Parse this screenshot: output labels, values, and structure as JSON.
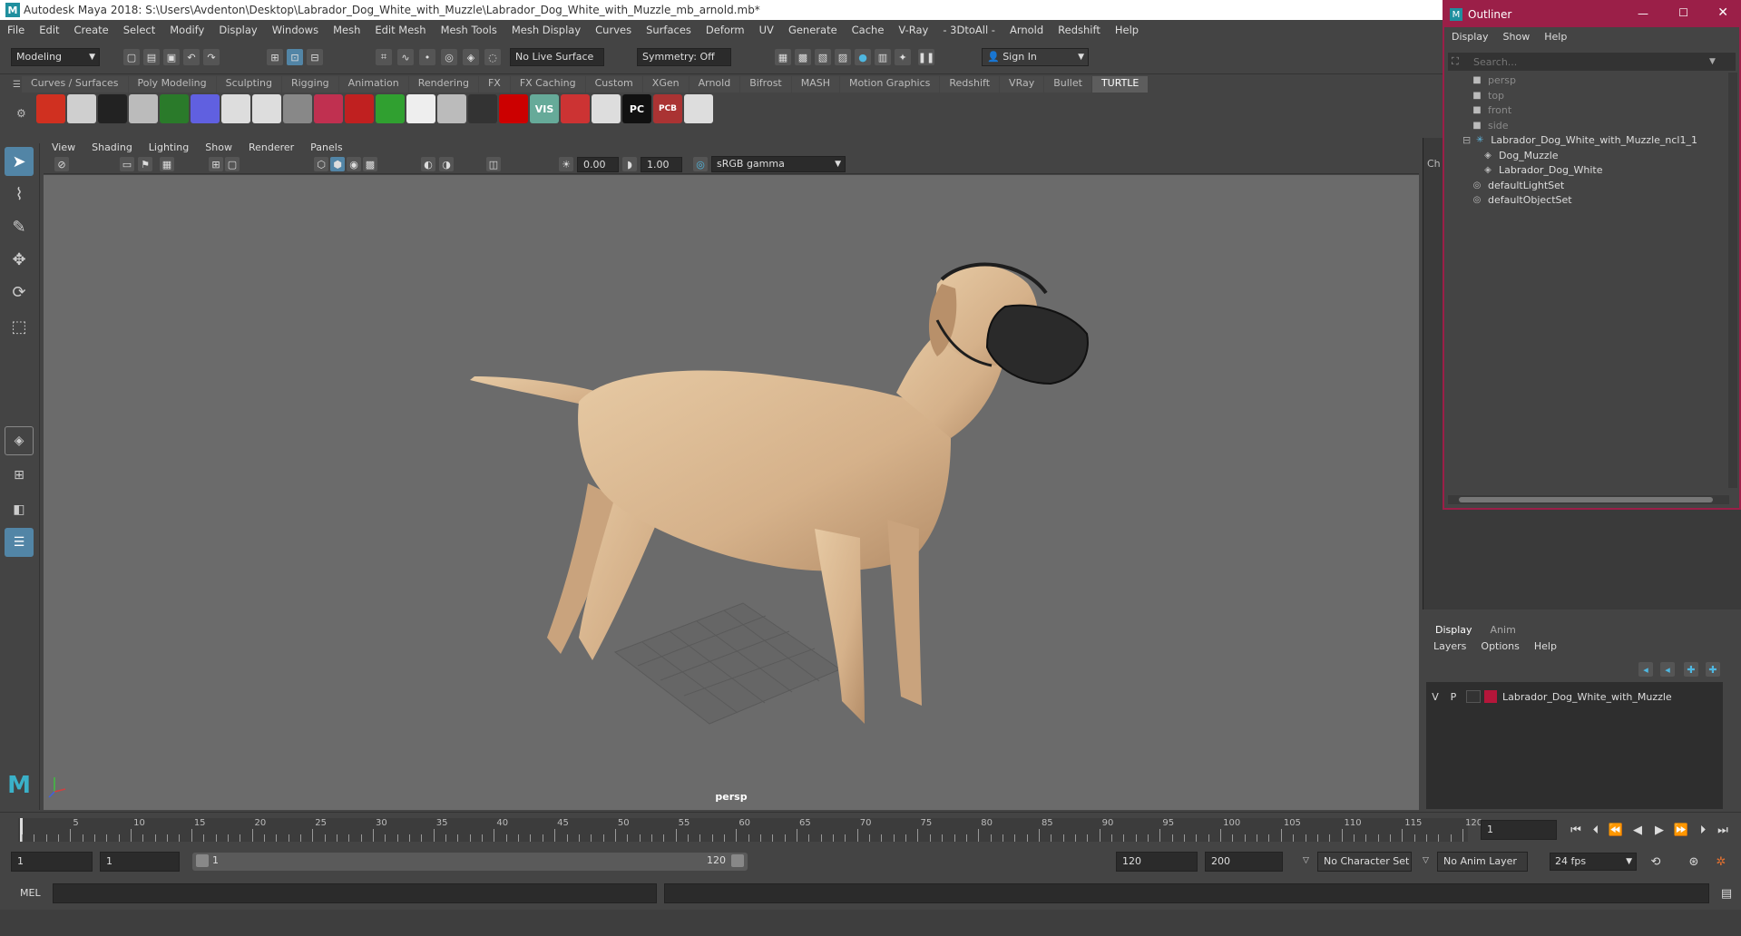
{
  "window": {
    "title": "Autodesk Maya 2018: S:\\Users\\Avdenton\\Desktop\\Labrador_Dog_White_with_Muzzle\\Labrador_Dog_White_with_Muzzle_mb_arnold.mb*"
  },
  "menubar": [
    "File",
    "Edit",
    "Create",
    "Select",
    "Modify",
    "Display",
    "Windows",
    "Mesh",
    "Edit Mesh",
    "Mesh Tools",
    "Mesh Display",
    "Curves",
    "Surfaces",
    "Deform",
    "UV",
    "Generate",
    "Cache",
    "V-Ray",
    "- 3DtoAll -",
    "Arnold",
    "Redshift",
    "Help"
  ],
  "statusline": {
    "mode": "Modeling",
    "live_surface": "No Live Surface",
    "symmetry": "Symmetry: Off",
    "sign_in": "Sign In"
  },
  "shelf_tabs": [
    "Curves / Surfaces",
    "Poly Modeling",
    "Sculpting",
    "Rigging",
    "Animation",
    "Rendering",
    "FX",
    "FX Caching",
    "Custom",
    "XGen",
    "Arnold",
    "Bifrost",
    "MASH",
    "Motion Graphics",
    "Redshift",
    "VRay",
    "Bullet",
    "TURTLE"
  ],
  "shelf_active": "TURTLE",
  "shelf_icon_labels": {
    "vis": "VIS",
    "pc": "PC",
    "pcb": "PCB"
  },
  "viewport": {
    "menu": [
      "View",
      "Shading",
      "Lighting",
      "Show",
      "Renderer",
      "Panels"
    ],
    "exposure": "0.00",
    "gamma": "1.00",
    "colorspace": "sRGB gamma",
    "camera_label": "persp"
  },
  "channel_box_label": "Ch",
  "outliner": {
    "title": "Outliner",
    "menu": [
      "Display",
      "Show",
      "Help"
    ],
    "search_placeholder": "Search...",
    "items": [
      {
        "label": "persp",
        "icon": "camera-icon",
        "dim": true,
        "indent": 0
      },
      {
        "label": "top",
        "icon": "camera-icon",
        "dim": true,
        "indent": 0
      },
      {
        "label": "front",
        "icon": "camera-icon",
        "dim": true,
        "indent": 0
      },
      {
        "label": "side",
        "icon": "camera-icon",
        "dim": true,
        "indent": 0
      },
      {
        "label": "Labrador_Dog_White_with_Muzzle_ncl1_1",
        "icon": "group-icon",
        "dim": false,
        "indent": 0
      },
      {
        "label": "Dog_Muzzle",
        "icon": "mesh-icon",
        "dim": false,
        "indent": 1
      },
      {
        "label": "Labrador_Dog_White",
        "icon": "mesh-icon",
        "dim": false,
        "indent": 1
      },
      {
        "label": "defaultLightSet",
        "icon": "set-icon",
        "dim": false,
        "indent": 0
      },
      {
        "label": "defaultObjectSet",
        "icon": "set-icon",
        "dim": false,
        "indent": 0
      }
    ]
  },
  "layer_editor": {
    "tabs": [
      "Display",
      "Anim"
    ],
    "menu": [
      "Layers",
      "Options",
      "Help"
    ],
    "layer": {
      "v": "V",
      "p": "P",
      "name": "Labrador_Dog_White_with_Muzzle",
      "color": "#b5163a"
    }
  },
  "timeslider": {
    "ticks": [
      "5",
      "10",
      "15",
      "20",
      "25",
      "30",
      "35",
      "40",
      "45",
      "50",
      "55",
      "60",
      "65",
      "70",
      "75",
      "80",
      "85",
      "90",
      "95",
      "100",
      "105",
      "110",
      "115",
      "120"
    ],
    "current_frame": "1"
  },
  "range": {
    "start": "1",
    "playback_start": "1",
    "slider_start": "1",
    "slider_end": "120",
    "playback_end": "120",
    "end": "200",
    "character_set": "No Character Set",
    "anim_layer": "No Anim Layer",
    "fps": "24 fps"
  },
  "cmdline": {
    "label": "MEL"
  }
}
